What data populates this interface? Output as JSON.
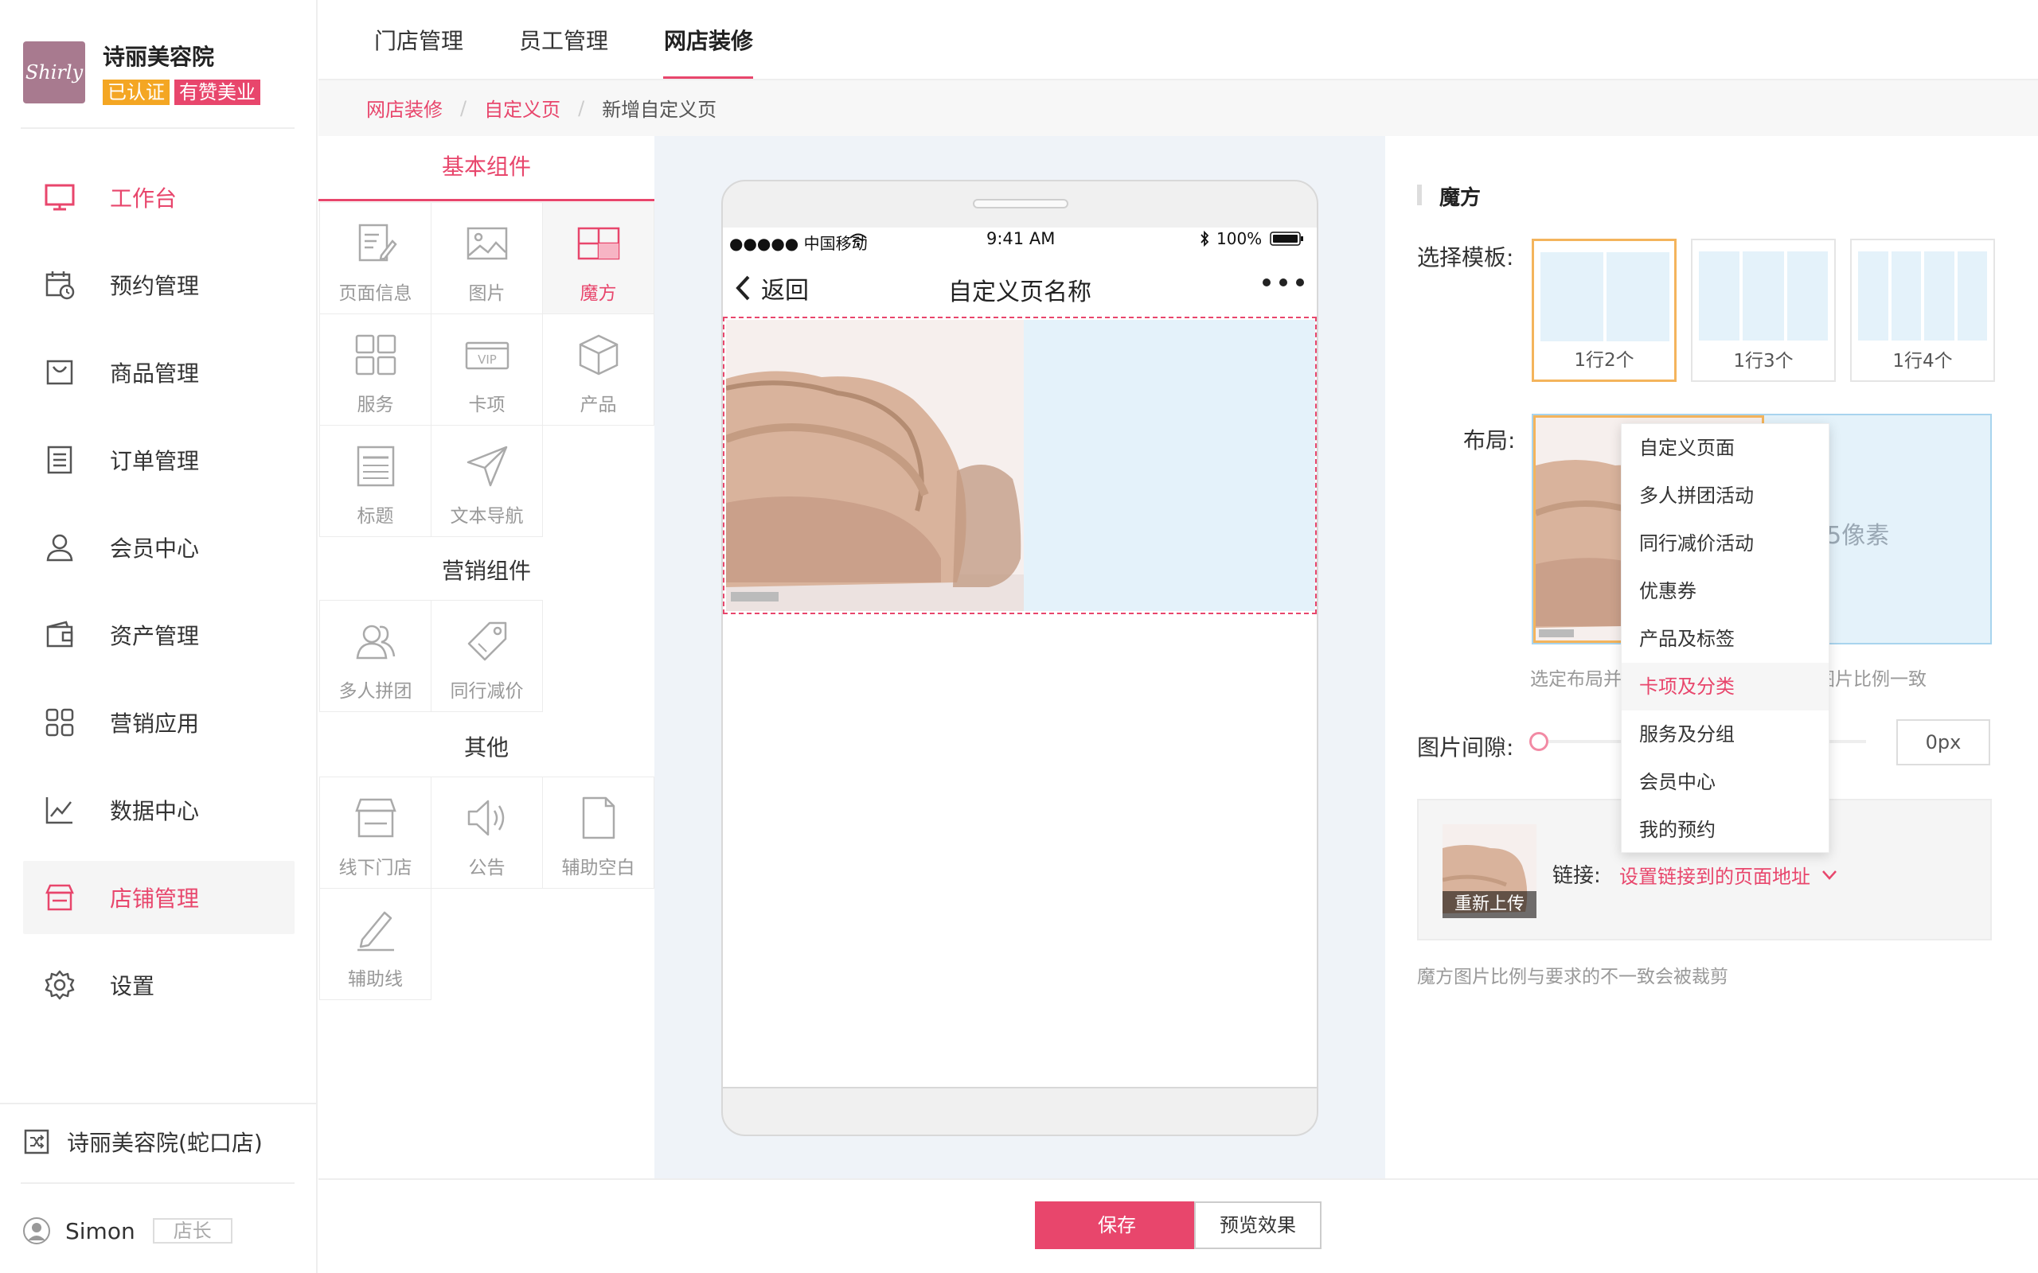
{
  "sidebar": {
    "logo_text": "Shirly",
    "store_name": "诗丽美容院",
    "badge_verified": "已认证",
    "badge_brand": "有赞美业",
    "items": [
      {
        "label": "工作台",
        "icon": "monitor-icon"
      },
      {
        "label": "预约管理",
        "icon": "calendar-clock-icon"
      },
      {
        "label": "商品管理",
        "icon": "bag-icon"
      },
      {
        "label": "订单管理",
        "icon": "document-list-icon"
      },
      {
        "label": "会员中心",
        "icon": "user-icon"
      },
      {
        "label": "资产管理",
        "icon": "wallet-icon"
      },
      {
        "label": "营销应用",
        "icon": "apps-grid-icon"
      },
      {
        "label": "数据中心",
        "icon": "chart-line-icon"
      },
      {
        "label": "店铺管理",
        "icon": "store-icon"
      },
      {
        "label": "设置",
        "icon": "gear-icon"
      }
    ],
    "branch": "诗丽美容院(蛇口店)",
    "user_name": "Simon",
    "user_role": "店长"
  },
  "top_tabs": [
    "门店管理",
    "员工管理",
    "网店装修"
  ],
  "breadcrumb": {
    "items": [
      "网店装修",
      "自定义页"
    ],
    "current": "新增自定义页"
  },
  "components": {
    "header": "基本组件",
    "basic": [
      {
        "label": "页面信息",
        "icon": "page-info-icon"
      },
      {
        "label": "图片",
        "icon": "image-icon"
      },
      {
        "label": "魔方",
        "icon": "cube-layout-icon"
      },
      {
        "label": "服务",
        "icon": "service-grid-icon"
      },
      {
        "label": "卡项",
        "icon": "vip-card-icon"
      },
      {
        "label": "产品",
        "icon": "box-icon"
      },
      {
        "label": "标题",
        "icon": "title-icon"
      },
      {
        "label": "文本导航",
        "icon": "paper-plane-icon"
      }
    ],
    "marketing_title": "营销组件",
    "marketing": [
      {
        "label": "多人拼团",
        "icon": "group-icon"
      },
      {
        "label": "同行减价",
        "icon": "price-tag-icon"
      }
    ],
    "other_title": "其他",
    "other": [
      {
        "label": "线下门店",
        "icon": "shop-icon"
      },
      {
        "label": "公告",
        "icon": "speaker-icon"
      },
      {
        "label": "辅助空白",
        "icon": "blank-page-icon"
      },
      {
        "label": "辅助线",
        "icon": "pencil-icon"
      }
    ]
  },
  "phone": {
    "carrier": "●●●●● 中国移动",
    "time": "9:41 AM",
    "battery": "100%",
    "back_label": "返回",
    "page_title": "自定义页名称"
  },
  "settings": {
    "title": "魔方",
    "template_label": "选择模板:",
    "templates": [
      "1行2个",
      "1行3个",
      "1行4个"
    ],
    "layout_label": "布局:",
    "layout_hint_big": "度375像素",
    "layout_hint": "选定布局并",
    "layout_hint_tail": "图片比例一致",
    "gap_label": "图片间隙:",
    "gap_value": "0px",
    "reupload": "重新上传",
    "link_label": "链接:",
    "link_value": "设置链接到的页面地址",
    "crop_hint": "魔方图片比例与要求的不一致会被裁剪"
  },
  "dropdown": {
    "items": [
      "自定义页面",
      "多人拼团活动",
      "同行减价活动",
      "优惠券",
      "产品及标签",
      "卡项及分类",
      "服务及分组",
      "会员中心",
      "我的预约"
    ],
    "highlighted": "卡项及分类"
  },
  "footer": {
    "save": "保存",
    "preview": "预览效果"
  },
  "colors": {
    "accent": "#e8466c",
    "badge_orange": "#f4a623",
    "cube_blue": "#e4f2fa",
    "template_selected": "#f4b45c"
  }
}
